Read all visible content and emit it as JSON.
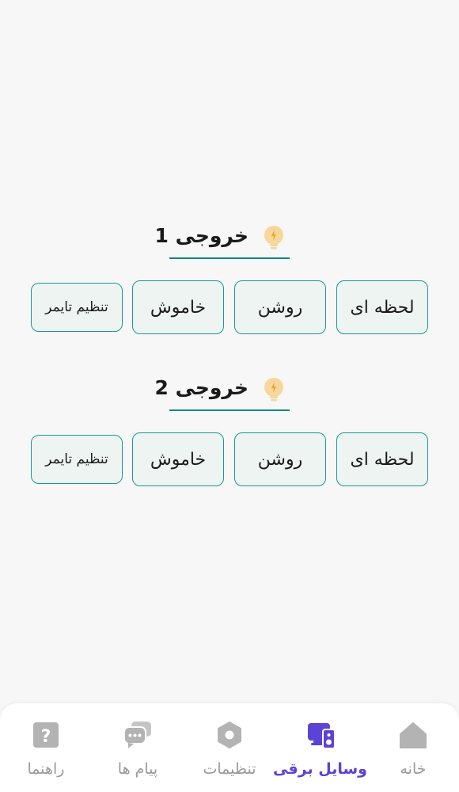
{
  "outputs": [
    {
      "title": "خروجی 1",
      "buttons": {
        "moment": "لحظه ای",
        "on": "روشن",
        "off": "خاموش",
        "timer": "تنظیم تایمر"
      }
    },
    {
      "title": "خروجی 2",
      "buttons": {
        "moment": "لحظه ای",
        "on": "روشن",
        "off": "خاموش",
        "timer": "تنظیم تایمر"
      }
    }
  ],
  "nav": {
    "home": "خانه",
    "devices": "وسایل برقی",
    "settings": "تنظیمات",
    "messages": "پیام ها",
    "help": "راهنما",
    "active": "devices"
  },
  "colors": {
    "accent": "#189a8c",
    "active_nav": "#5b43d6",
    "inactive_nav": "#9a9a9a",
    "bulb": "#f7d79a"
  },
  "icons": {
    "output_title": "lightbulb-icon",
    "home": "home-icon",
    "devices": "devices-icon",
    "settings": "hexagon-settings-icon",
    "messages": "chat-icon",
    "help": "question-icon"
  }
}
